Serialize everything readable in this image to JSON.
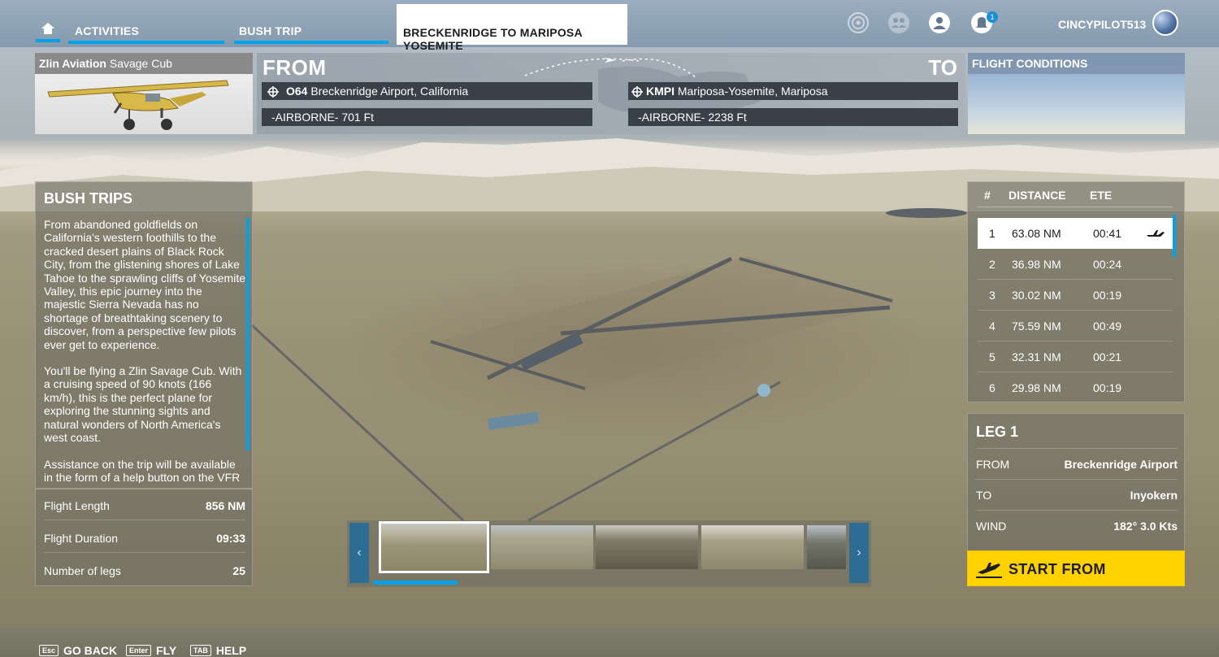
{
  "nav": {
    "home_icon": "home-icon",
    "activities": "ACTIVITIES",
    "bush_trip": "BUSH TRIP",
    "active_tab": "BRECKENRIDGE TO MARIPOSA YOSEMITE",
    "notification_count": "1",
    "username": "CINCYPILOT513",
    "icons": [
      "compass-icon",
      "friends-icon",
      "profile-icon",
      "bell-icon"
    ]
  },
  "aircraft": {
    "maker": "Zlin Aviation",
    "model": "Savage Cub"
  },
  "route": {
    "from_label": "FROM",
    "to_label": "TO",
    "from_code": "O64",
    "from_name": "Breckenridge Airport, California",
    "from_alt": "-AIRBORNE- 701 Ft",
    "to_code": "KMPI",
    "to_name": "Mariposa-Yosemite, Mariposa",
    "to_alt": "-AIRBORNE- 2238 Ft"
  },
  "conditions": {
    "title": "FLIGHT CONDITIONS"
  },
  "bush": {
    "title": "BUSH TRIPS",
    "paragraphs": [
      "From abandoned goldfields on California's western foothills to the cracked desert plains of Black Rock City, from the glistening shores of Lake Tahoe to the sprawling cliffs of Yosemite Valley, this epic journey into the majestic Sierra Nevada has no shortage of breathtaking scenery to discover, from a perspective few pilots ever get to experience.",
      "You'll be flying a Zlin Savage Cub. With a cruising speed of 90 knots (166 km/h), this is the perfect plane for exploring the stunning sights and natural wonders of North America's west coast.",
      "Assistance on the trip will be available in the form of a help button on the VFR"
    ]
  },
  "stats": [
    {
      "label": "Flight Length",
      "value": "856 NM"
    },
    {
      "label": "Flight Duration",
      "value": "09:33"
    },
    {
      "label": "Number of legs",
      "value": "25"
    }
  ],
  "legs": {
    "headers": {
      "num": "#",
      "distance": "DISTANCE",
      "ete": "ETE"
    },
    "selected_index": 0,
    "rows": [
      {
        "num": "1",
        "distance": "63.08 NM",
        "ete": "00:41"
      },
      {
        "num": "2",
        "distance": "36.98 NM",
        "ete": "00:24"
      },
      {
        "num": "3",
        "distance": "30.02 NM",
        "ete": "00:19"
      },
      {
        "num": "4",
        "distance": "75.59 NM",
        "ete": "00:49"
      },
      {
        "num": "5",
        "distance": "32.31 NM",
        "ete": "00:21"
      },
      {
        "num": "6",
        "distance": "29.98 NM",
        "ete": "00:19"
      }
    ]
  },
  "leg_detail": {
    "title": "LEG 1",
    "from_label": "FROM",
    "from_value": "Breckenridge Airport",
    "to_label": "TO",
    "to_value": "Inyokern",
    "wind_label": "WIND",
    "wind_value": "182° 3.0 Kts"
  },
  "start": {
    "label": "START FROM",
    "icon": "departure-icon"
  },
  "thumbs": {
    "prev": "‹",
    "next": "›"
  },
  "footer": {
    "back_key": "Esc",
    "back_label": "GO BACK",
    "fly_key": "Enter",
    "fly_label": "FLY",
    "help_key": "TAB",
    "help_label": "HELP"
  },
  "colors": {
    "accent": "#00a2e8",
    "start_button": "#ffd200",
    "field_bg": "#3a4048"
  }
}
